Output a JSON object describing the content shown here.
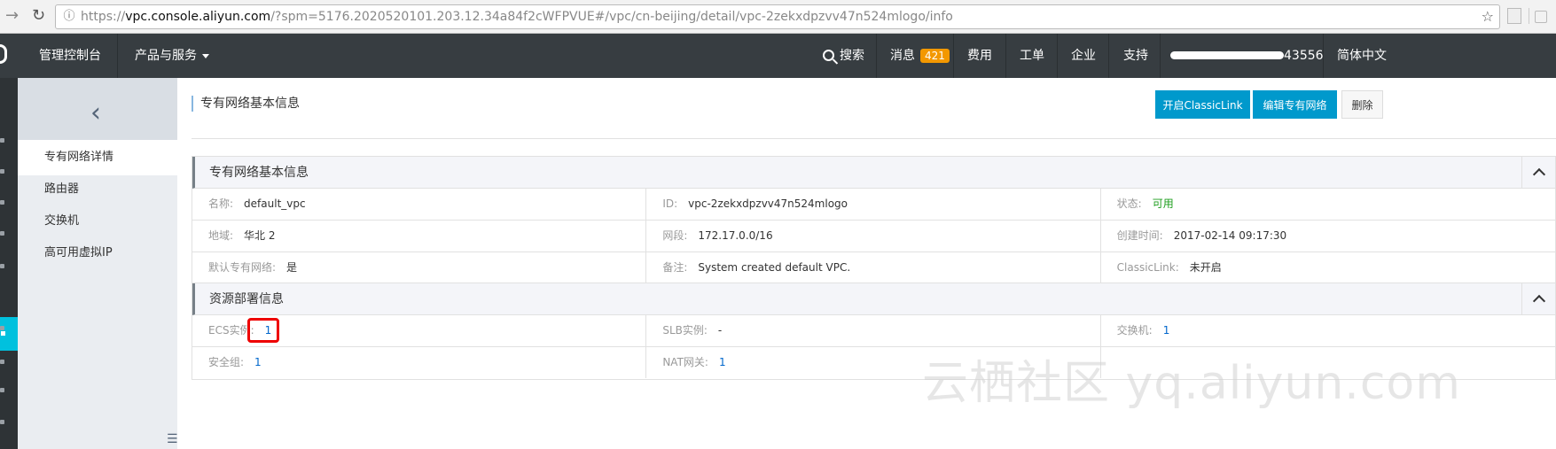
{
  "browser": {
    "url_host": "vpc.console.aliyun.com",
    "url_prefix": "https://",
    "url_rest": "/?spm=5176.2020520101.203.12.34a84f2cWFPVUE#/vpc/cn-beijing/detail/vpc-2zekxdpzvv47n524mlogo/info",
    "icons": [
      "back-arrow-icon",
      "reload-icon",
      "info-icon",
      "star-icon"
    ]
  },
  "topnav": {
    "console": "管理控制台",
    "products": "产品与服务",
    "search": "搜索",
    "messages": "消息",
    "messages_count": "421",
    "billing": "费用",
    "tickets": "工单",
    "enterprise": "企业",
    "support": "支持",
    "account_suffix": "43556",
    "language": "简体中文"
  },
  "sidebar": {
    "items": [
      {
        "label": "专有网络详情",
        "active": true
      },
      {
        "label": "路由器",
        "active": false
      },
      {
        "label": "交换机",
        "active": false
      },
      {
        "label": "高可用虚拟IP",
        "active": false
      }
    ]
  },
  "page": {
    "title": "专有网络基本信息",
    "buttons": {
      "classiclink": "开启ClassicLink",
      "edit": "编辑专有网络",
      "delete": "删除"
    }
  },
  "basic": {
    "title": "专有网络基本信息",
    "name_k": "名称:",
    "name_v": "default_vpc",
    "id_k": "ID:",
    "id_v": "vpc-2zekxdpzvv47n524mlogo",
    "status_k": "状态:",
    "status_v": "可用",
    "region_k": "地域:",
    "region_v": "华北 2",
    "cidr_k": "网段:",
    "cidr_v": "172.17.0.0/16",
    "created_k": "创建时间:",
    "created_v": "2017-02-14 09:17:30",
    "default_k": "默认专有网络:",
    "default_v": "是",
    "note_k": "备注:",
    "note_v": "System created default VPC.",
    "classiclink_k": "ClassicLink:",
    "classiclink_v": "未开启"
  },
  "resources": {
    "title": "资源部署信息",
    "ecs_k": "ECS实例:",
    "ecs_v": "1",
    "slb_k": "SLB实例:",
    "slb_v": "-",
    "vswitch_k": "交换机:",
    "vswitch_v": "1",
    "sg_k": "安全组:",
    "sg_v": "1",
    "nat_k": "NAT网关:",
    "nat_v": "1"
  },
  "watermark": "云栖社区 yq.aliyun.com",
  "colors": {
    "topnav_bg": "#373d41",
    "accent": "#00c1de",
    "primary_button": "#0099cc",
    "badge": "#f39800",
    "status_green": "#1e9e1e"
  }
}
